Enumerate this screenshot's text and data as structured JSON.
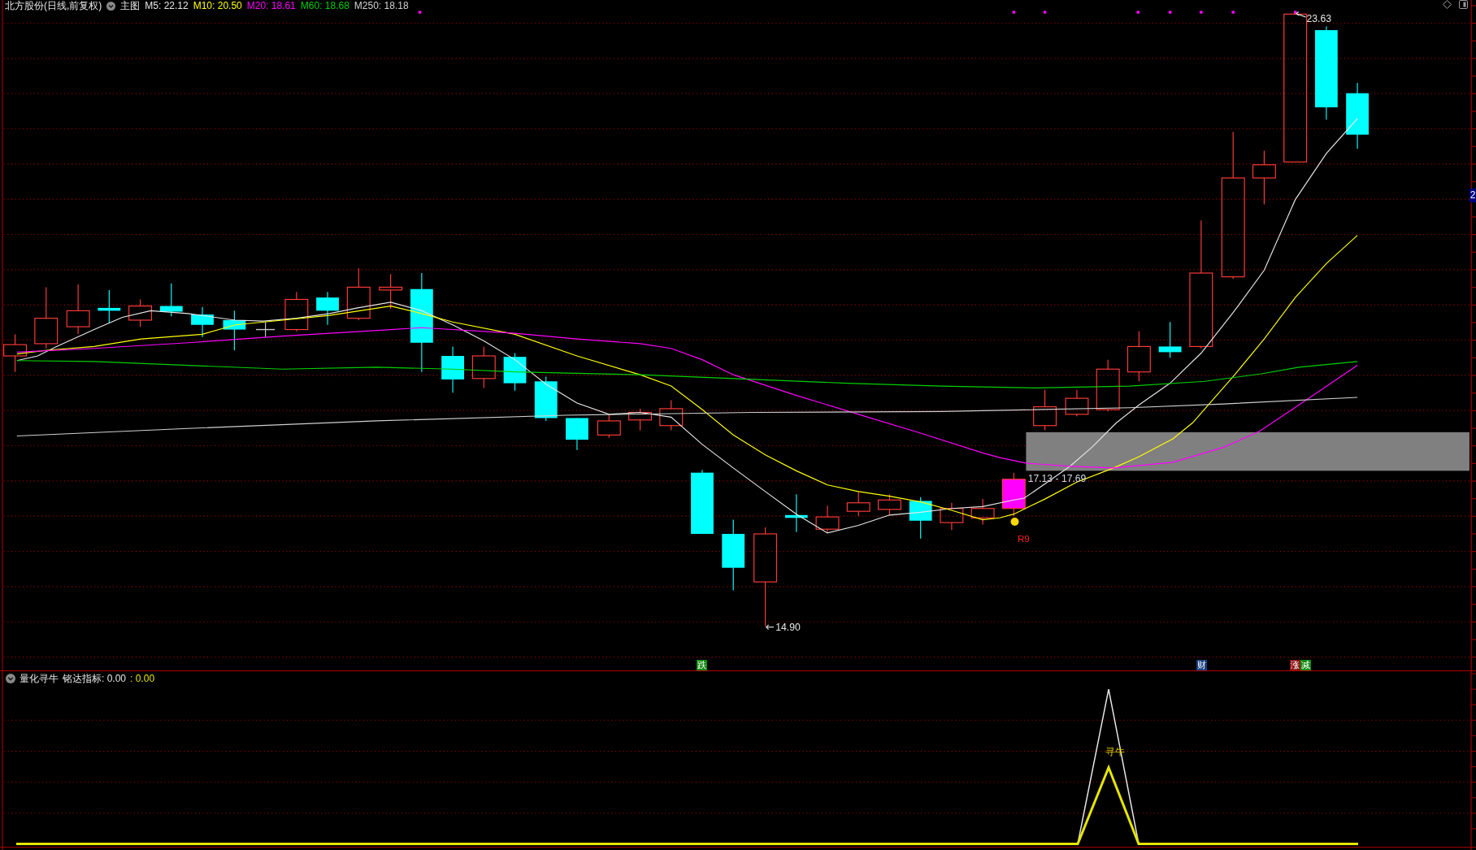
{
  "main_chart": {
    "title": "北方股份(日线,前复权)",
    "view": "主图",
    "moving_averages": [
      {
        "label": "M5: 22.12",
        "color": "#e6e6e6"
      },
      {
        "label": "M10: 20.50",
        "color": "#ffff00"
      },
      {
        "label": "M20: 18.61",
        "color": "#ff00ff"
      },
      {
        "label": "M60: 18.68",
        "color": "#00d000"
      },
      {
        "label": "M250: 18.18",
        "color": "#d0d0d0"
      }
    ],
    "high_label": "23.63",
    "low_label": "14.90",
    "zone_label": "17.13 - 17.69",
    "signal_label": "R9",
    "axis_label": "2",
    "event_tags": [
      {
        "text": "跌",
        "color": "#108a10"
      },
      {
        "text": "财",
        "color": "#1a3f80"
      },
      {
        "text": "涨",
        "color": "#8b1010"
      },
      {
        "text": "减",
        "color": "#108a10"
      }
    ]
  },
  "indicator": {
    "name": "量化寻牛",
    "readings": [
      {
        "label": "铭达指标: 0.00",
        "color": "#e6e6e6"
      },
      {
        "label": ": 0.00",
        "color": "#e6e600"
      }
    ],
    "signal_label": "寻牛"
  }
}
